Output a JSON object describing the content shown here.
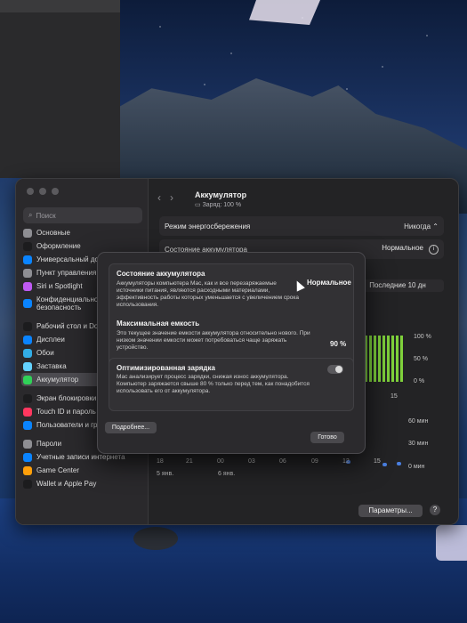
{
  "sidebar": {
    "search_placeholder": "Поиск",
    "items": [
      {
        "label": "Основные",
        "color": "#8e8e93"
      },
      {
        "label": "Оформление",
        "color": "#1c1c1e"
      },
      {
        "label": "Универсальный доступ",
        "color": "#0a84ff"
      },
      {
        "label": "Пункт управления",
        "color": "#8e8e93"
      },
      {
        "label": "Siri и Spotlight",
        "color": "#bf5af2"
      },
      {
        "label": "Конфиденциальность и безопасность",
        "color": "#0a84ff"
      },
      {
        "label": "Рабочий стол и Dock",
        "color": "#1c1c1e"
      },
      {
        "label": "Дисплеи",
        "color": "#0a84ff"
      },
      {
        "label": "Обои",
        "color": "#32ade6"
      },
      {
        "label": "Заставка",
        "color": "#64d2ff"
      },
      {
        "label": "Аккумулятор",
        "color": "#30d158"
      },
      {
        "label": "Экран блокировки",
        "color": "#1c1c1e"
      },
      {
        "label": "Touch ID и пароль",
        "color": "#ff375f"
      },
      {
        "label": "Пользователи и группы",
        "color": "#0a84ff"
      },
      {
        "label": "Пароли",
        "color": "#8e8e93"
      },
      {
        "label": "Учетные записи интернета",
        "color": "#0a84ff"
      },
      {
        "label": "Game Center",
        "color": "#ff9f0a"
      },
      {
        "label": "Wallet и Apple Pay",
        "color": "#1c1c1e"
      }
    ]
  },
  "header": {
    "title": "Аккумулятор",
    "subtitle": "Заряд: 100 %"
  },
  "settings_rows": {
    "energy_mode_label": "Режим энергосбережения",
    "energy_mode_value": "Никогда",
    "battery_state_label": "Состояние аккумулятора",
    "battery_state_value": "Нормальное",
    "chart_tab": "Последние 10 дн"
  },
  "chart": {
    "level_ticks": [
      "100 %",
      "50 %",
      "0 %"
    ],
    "time_ticks": [
      "60 мин",
      "30 мин",
      "0 мин"
    ],
    "x_labels": [
      "18",
      "21",
      "00",
      "03",
      "06",
      "09",
      "12",
      "15"
    ],
    "x_sub": [
      "5 янв.",
      "6 янв."
    ],
    "x_upper": "15"
  },
  "footer": {
    "params_button": "Параметры...",
    "help": "?"
  },
  "dialog": {
    "state_title": "Состояние аккумулятора",
    "state_value": "Нормальное",
    "state_text": "Аккумуляторы компьютера Mac, как и все перезаряжаемые источники питания, являются расходными материалами, эффективность работы которых уменьшается с увеличением срока использования.",
    "capacity_title": "Максимальная емкость",
    "capacity_value": "90 %",
    "capacity_text": "Это текущее значение емкости аккумулятора относительно нового. При низком значении емкости может потребоваться чаще заряжать устройство.",
    "optimized_title": "Оптимизированная зарядка",
    "optimized_text": "Мас анализирует процесс зарядки, снижая износ аккумулятора. Компьютер заряжается свыше 80 % только перед тем, как понадобится использовать его от аккумулятора.",
    "optimized_on": false,
    "more_button": "Подробнее...",
    "done_button": "Готово"
  }
}
